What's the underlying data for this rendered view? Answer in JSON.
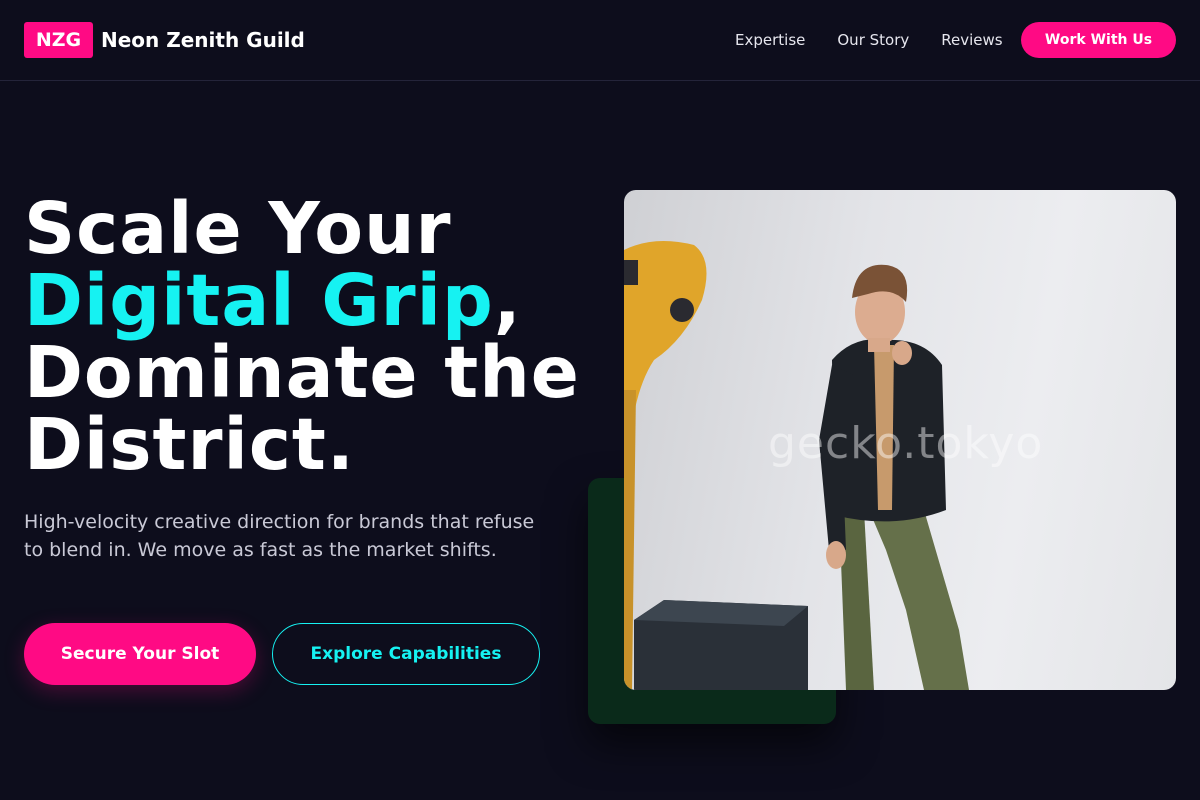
{
  "header": {
    "logo_abbr": "NZG",
    "brand_name": "Neon Zenith Guild",
    "nav": [
      {
        "label": "Expertise"
      },
      {
        "label": "Our Story"
      },
      {
        "label": "Reviews"
      }
    ],
    "cta_label": "Work With Us"
  },
  "hero": {
    "headline_line1": "Scale Your",
    "headline_accent": "Digital Grip",
    "headline_comma": ",",
    "headline_line3": "Dominate the",
    "headline_line4": "District.",
    "subtext": "High-velocity creative direction for brands that refuse to blend in. We move as fast as the market shifts.",
    "primary_button": "Secure Your Slot",
    "secondary_button": "Explore Capabilities"
  },
  "image": {
    "watermark": "gecko.tokyo"
  },
  "colors": {
    "background": "#0d0d1c",
    "brand_pink": "#ff0a84",
    "accent_cyan": "#16f2f2",
    "text_white": "#ffffff"
  }
}
